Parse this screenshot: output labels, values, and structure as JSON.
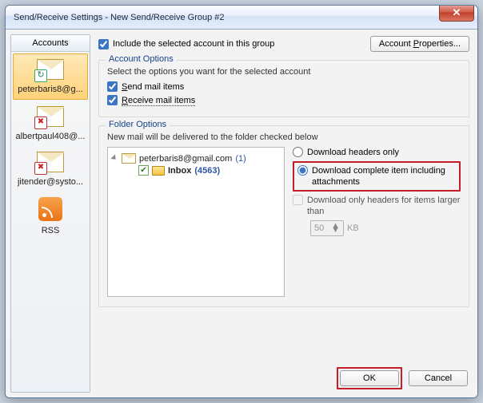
{
  "window": {
    "title": "Send/Receive Settings - New Send/Receive Group #2"
  },
  "sidebar": {
    "header": "Accounts",
    "items": [
      {
        "label": "peterbaris8@g..."
      },
      {
        "label": "albertpaul408@..."
      },
      {
        "label": "jitender@systo..."
      },
      {
        "label": "RSS"
      }
    ]
  },
  "top": {
    "include_label": "Include the selected account in this group",
    "account_props_btn_prefix": "Account ",
    "account_props_btn_und": "P",
    "account_props_btn_suffix": "roperties..."
  },
  "account_options": {
    "title": "Account Options",
    "help": "Select the options you want for the selected account",
    "send_prefix": "",
    "send_und": "S",
    "send_suffix": "end mail items",
    "recv_und": "R",
    "recv_suffix": "eceive mail items"
  },
  "folder_options": {
    "title": "Folder Options",
    "help": "New mail will be delivered to the folder checked below",
    "tree": {
      "root_name": "peterbaris8@gmail.com",
      "root_count": "(1)",
      "inbox_label": "Inbox",
      "inbox_count": "(4563)"
    },
    "opts": {
      "headers_only": "Download headers only",
      "complete": "Download complete item including attachments",
      "only_headers_larger": "Download only headers for items larger than",
      "size_value": "50",
      "size_unit": "KB"
    }
  },
  "footer": {
    "ok": "OK",
    "cancel": "Cancel"
  }
}
